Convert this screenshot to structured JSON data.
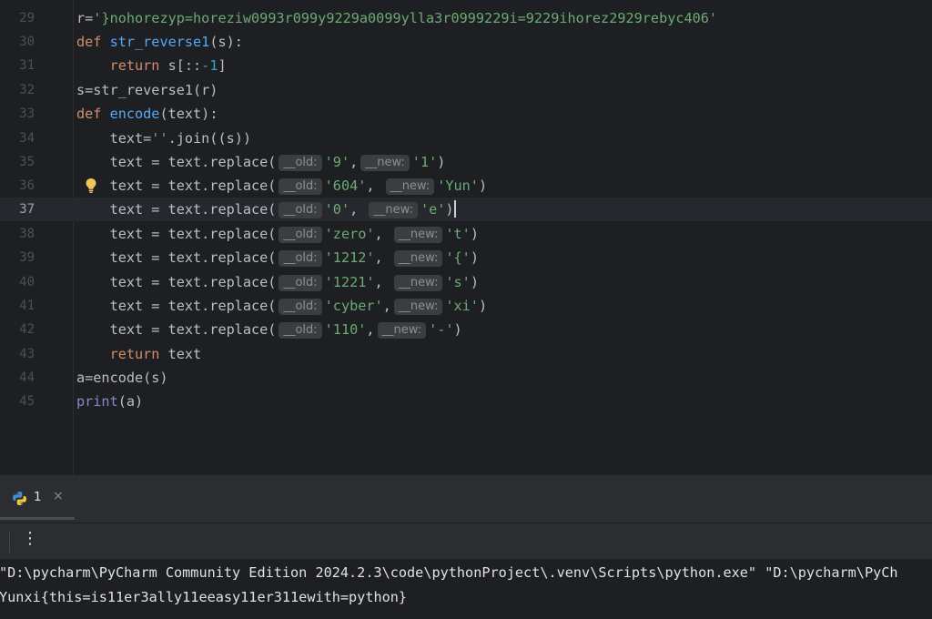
{
  "editor": {
    "line_numbers": [
      "29",
      "30",
      "31",
      "32",
      "33",
      "34",
      "35",
      "36",
      "37",
      "38",
      "39",
      "40",
      "41",
      "42",
      "43",
      "44",
      "45"
    ],
    "current_line": "37",
    "code": {
      "l29_var": "r=",
      "l29_str": "'}nohorezyp=horeziw0993r099y9229a0099ylla3r0999229i=9229ihorez2929rebyc406'",
      "kw_def": "def",
      "kw_return": "return",
      "fn_str_reverse1": "str_reverse1",
      "fn_encode": "encode",
      "l30_tail": "(s):",
      "l31_s": " s[::",
      "l31_num": "-1",
      "l31_end": "]",
      "l32": "s=str_reverse1(r)",
      "l33_tail": "(text):",
      "l34_a": "text=",
      "l34_str": "''",
      "l34_b": ".join((s))",
      "replace_prefix": "text = text.replace(",
      "hint_old": "__old:",
      "hint_new": "__new:",
      "comma": ",",
      "close_paren": ")",
      "r35": [
        "'9'",
        "'1'"
      ],
      "r36": [
        "'604'",
        "'Yun'"
      ],
      "r37": [
        "'0'",
        "'e'"
      ],
      "r38": [
        "'zero'",
        "'t'"
      ],
      "r39": [
        "'1212'",
        "'{'"
      ],
      "r40": [
        "'1221'",
        "'s'"
      ],
      "r41": [
        "'cyber'",
        "'xi'"
      ],
      "r42": [
        "'110'",
        "'-'"
      ],
      "l43_tail": " text",
      "l44": "a=encode(s)",
      "l45_print": "print",
      "l45_tail": "(a)"
    }
  },
  "run_panel": {
    "tab_label": "1",
    "close_symbol": "×",
    "kebab_symbol": "⋮",
    "console_lines": [
      "\"D:\\pycharm\\PyCharm Community Edition 2024.2.3\\code\\pythonProject\\.venv\\Scripts\\python.exe\" \"D:\\pycharm\\PyCh",
      "Yunxi{this=is11er3ally11eeasy11er311ewith=python}"
    ]
  },
  "colors": {
    "background": "#1e1f22",
    "keyword": "#cf8e6d",
    "function": "#56a8f5",
    "string": "#6aab73",
    "number": "#2aacb8",
    "hint_bg": "#3b3d40",
    "bulb": "#f2c55c"
  },
  "icons": [
    "lightbulb-icon",
    "python-icon",
    "close-icon",
    "more-options-icon"
  ]
}
